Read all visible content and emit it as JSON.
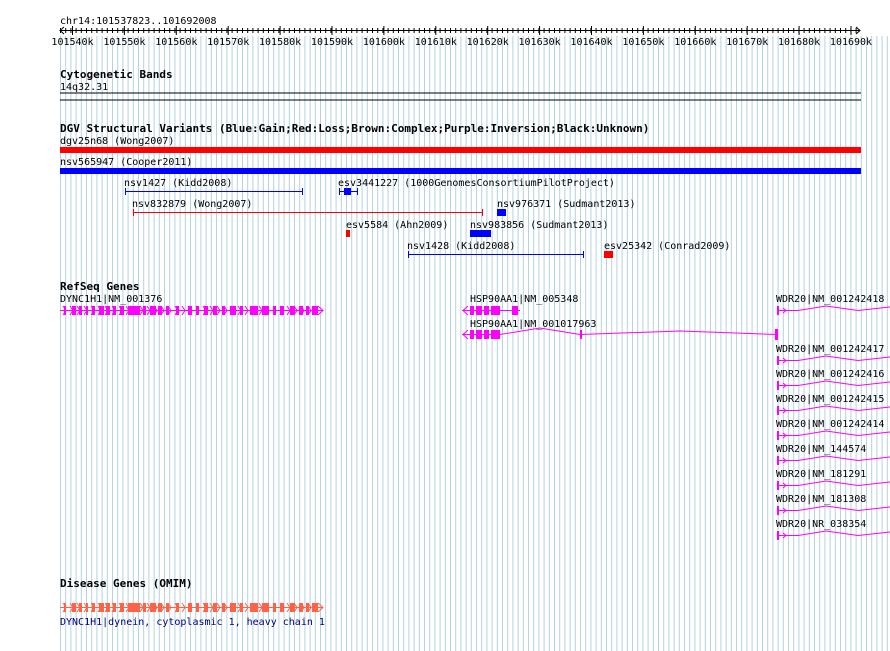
{
  "colors": {
    "grid": "#b4d2e0",
    "gain": "#0000ff",
    "loss": "#ff0000",
    "gene": "#ff00ff",
    "omim": "#ff6347",
    "omim_label": "#000080",
    "text": "#000000"
  },
  "ruler": {
    "location": "chr14:101537823..101692008",
    "ticks": [
      "101540k",
      "101550k",
      "101560k",
      "101570k",
      "101580k",
      "101590k",
      "101600k",
      "101610k",
      "101620k",
      "101630k",
      "101640k",
      "101650k",
      "101660k",
      "101670k",
      "101680k",
      "101690k"
    ]
  },
  "cytobands": {
    "title": "Cytogenetic Bands",
    "band": "14q32.31"
  },
  "dgv": {
    "title": "DGV Structural Variants (Blue:Gain;Red:Loss;Brown:Complex;Purple:Inversion;Black:Unknown)",
    "features": [
      {
        "label": "dgv25n68 (Wong2007)",
        "type": "loss"
      },
      {
        "label": "nsv565947 (Cooper2011)",
        "type": "gain"
      },
      {
        "label": "nsv1427 (Kidd2008)",
        "type": "gain"
      },
      {
        "label": "esv3441227 (1000GenomesConsortiumPilotProject)",
        "type": "gain"
      },
      {
        "label": "nsv832879 (Wong2007)",
        "type": "loss"
      },
      {
        "label": "nsv976371 (Sudmant2013)",
        "type": "gain"
      },
      {
        "label": "esv5584 (Ahn2009)",
        "type": "loss"
      },
      {
        "label": "nsv983856 (Sudmant2013)",
        "type": "gain"
      },
      {
        "label": "nsv1428 (Kidd2008)",
        "type": "gain"
      },
      {
        "label": "esv25342 (Conrad2009)",
        "type": "loss"
      }
    ]
  },
  "refseq": {
    "title": "RefSeq Genes",
    "genes": [
      "DYNC1H1|NM_001376",
      "HSP90AA1|NM_005348",
      "HSP90AA1|NM_001017963",
      "WDR20|NM_001242418",
      "WDR20|NM_001242417",
      "WDR20|NM_001242416",
      "WDR20|NM_001242415",
      "WDR20|NM_001242414",
      "WDR20|NM_144574",
      "WDR20|NM_181291",
      "WDR20|NM_181308",
      "WDR20|NR_038354"
    ]
  },
  "omim": {
    "title": "Disease Genes (OMIM)",
    "label": "DYNC1H1|dynein, cytoplasmic 1, heavy chain 1"
  }
}
